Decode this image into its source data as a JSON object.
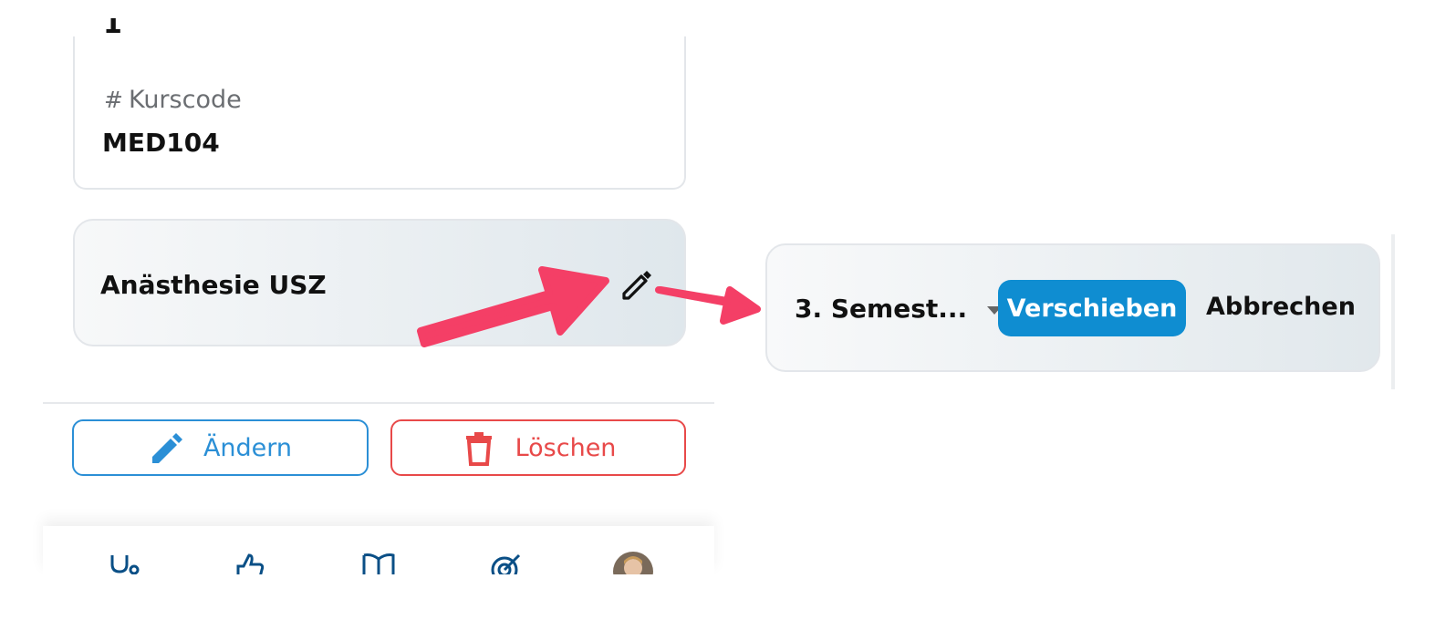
{
  "info_card": {
    "cut_value": "1",
    "field_icon": "hash-icon",
    "field_label": "Kurscode",
    "field_value": "MED104"
  },
  "course_card": {
    "name": "Anästhesie USZ",
    "edit_icon": "pencil-icon"
  },
  "actions": {
    "edit_label": "Ändern",
    "delete_label": "Löschen",
    "edit_color": "#2b8fd6",
    "delete_color": "#e84949"
  },
  "move_card": {
    "semester_value": "3. Semest...",
    "move_label": "Verschieben",
    "cancel_label": "Abbrechen",
    "move_color": "#0f8dd1"
  },
  "bottom_nav": {
    "items": [
      "stethoscope-icon",
      "thumbs-up-icon",
      "book-icon",
      "target-icon",
      "avatar"
    ]
  },
  "annotation_color": "#f43f66"
}
